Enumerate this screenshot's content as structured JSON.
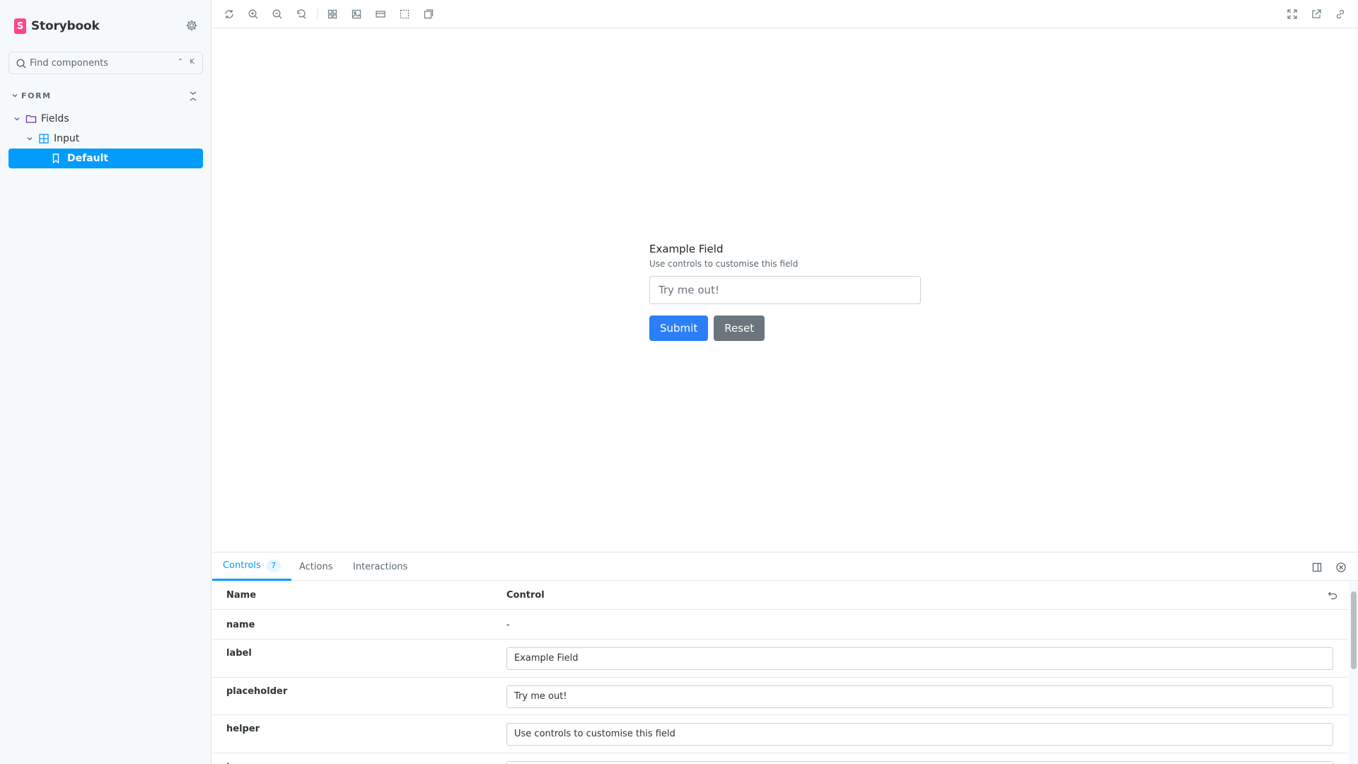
{
  "sidebar": {
    "brand": "Storybook",
    "search_placeholder": "Find components",
    "search_shortcut": "⌃ K",
    "group_label": "FORM",
    "tree": {
      "fields": "Fields",
      "input": "Input",
      "default": "Default"
    }
  },
  "toolbar": {
    "left_icons": [
      "reload-icon",
      "zoom-in-icon",
      "zoom-out-icon",
      "zoom-reset-icon",
      "grid-icon",
      "background-icon",
      "viewport-icon",
      "outline-icon",
      "measure-icon"
    ],
    "right_icons": [
      "fullscreen-icon",
      "open-new-tab-icon",
      "copy-link-icon"
    ]
  },
  "preview": {
    "label": "Example Field",
    "helper": "Use controls to customise this field",
    "placeholder": "Try me out!",
    "submit": "Submit",
    "reset": "Reset"
  },
  "panel": {
    "tabs": {
      "controls": "Controls",
      "controls_count": "7",
      "actions": "Actions",
      "interactions": "Interactions"
    },
    "head": {
      "name": "Name",
      "control": "Control"
    },
    "rows": [
      {
        "name": "name",
        "value": "-"
      },
      {
        "name": "label",
        "value": "Example Field"
      },
      {
        "name": "placeholder",
        "value": "Try me out!"
      },
      {
        "name": "helper",
        "value": "Use controls to customise this field"
      },
      {
        "name": "type",
        "value": ""
      }
    ]
  },
  "colors": {
    "accent": "#029cfd",
    "brand": "#ff4785",
    "submit": "#2b7ff7",
    "reset": "#6c757d"
  }
}
